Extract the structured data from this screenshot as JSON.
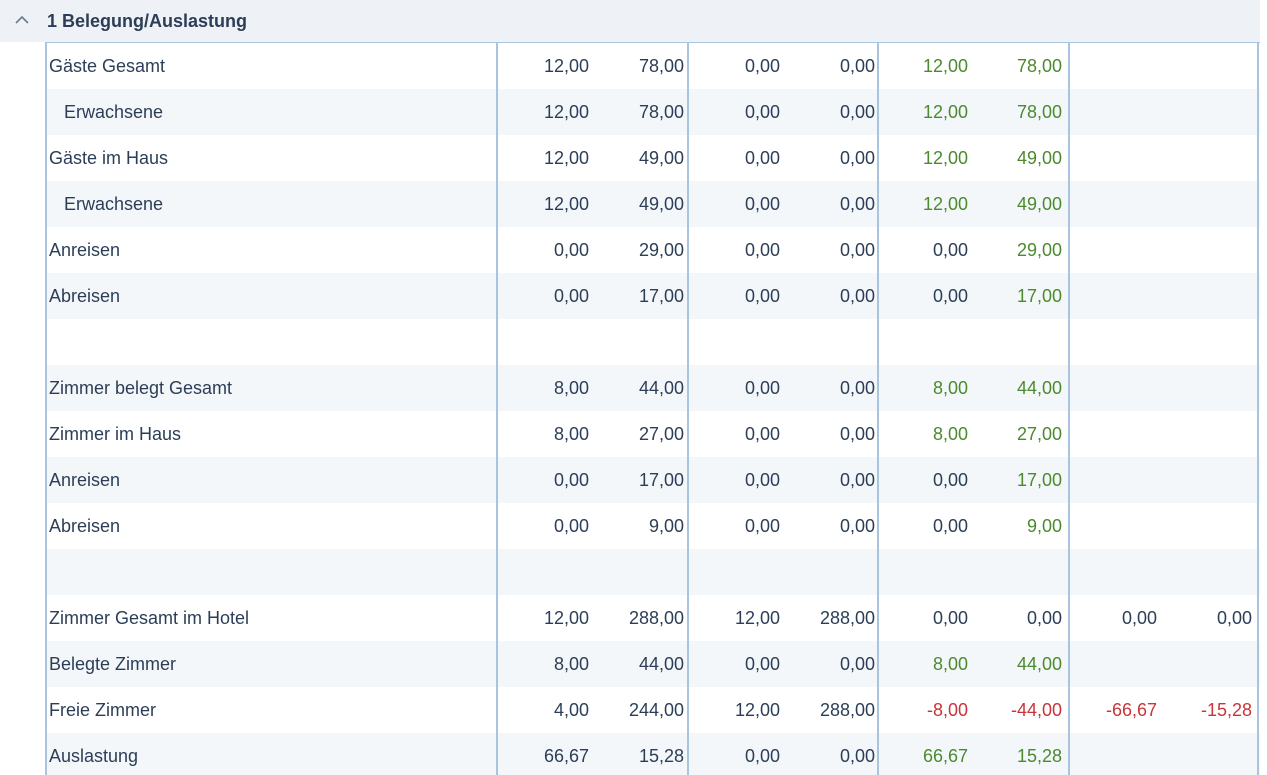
{
  "section": {
    "title": "1 Belegung/Auslastung",
    "icon": "chevron-up-icon"
  },
  "colors": {
    "green": "#4b8a2e",
    "red": "#c8343a",
    "text": "#2c3e57",
    "grid_line": "#a9c4de"
  },
  "rows": [
    {
      "label": "Gäste Gesamt",
      "indent": false,
      "values": [
        "12,00",
        "78,00",
        "0,00",
        "0,00",
        "12,00",
        "78,00",
        "",
        ""
      ],
      "tones": [
        "",
        "",
        "",
        "",
        "green",
        "green",
        "",
        ""
      ]
    },
    {
      "label": "Erwachsene",
      "indent": true,
      "values": [
        "12,00",
        "78,00",
        "0,00",
        "0,00",
        "12,00",
        "78,00",
        "",
        ""
      ],
      "tones": [
        "",
        "",
        "",
        "",
        "green",
        "green",
        "",
        ""
      ]
    },
    {
      "label": "Gäste im Haus",
      "indent": false,
      "values": [
        "12,00",
        "49,00",
        "0,00",
        "0,00",
        "12,00",
        "49,00",
        "",
        ""
      ],
      "tones": [
        "",
        "",
        "",
        "",
        "green",
        "green",
        "",
        ""
      ]
    },
    {
      "label": "Erwachsene",
      "indent": true,
      "values": [
        "12,00",
        "49,00",
        "0,00",
        "0,00",
        "12,00",
        "49,00",
        "",
        ""
      ],
      "tones": [
        "",
        "",
        "",
        "",
        "green",
        "green",
        "",
        ""
      ]
    },
    {
      "label": "Anreisen",
      "indent": false,
      "values": [
        "0,00",
        "29,00",
        "0,00",
        "0,00",
        "0,00",
        "29,00",
        "",
        ""
      ],
      "tones": [
        "",
        "",
        "",
        "",
        "",
        "green",
        "",
        ""
      ]
    },
    {
      "label": "Abreisen",
      "indent": false,
      "values": [
        "0,00",
        "17,00",
        "0,00",
        "0,00",
        "0,00",
        "17,00",
        "",
        ""
      ],
      "tones": [
        "",
        "",
        "",
        "",
        "",
        "green",
        "",
        ""
      ]
    },
    {
      "label": "",
      "indent": false,
      "values": [
        "",
        "",
        "",
        "",
        "",
        "",
        "",
        ""
      ],
      "tones": [
        "",
        "",
        "",
        "",
        "",
        "",
        "",
        ""
      ]
    },
    {
      "label": "Zimmer belegt Gesamt",
      "indent": false,
      "values": [
        "8,00",
        "44,00",
        "0,00",
        "0,00",
        "8,00",
        "44,00",
        "",
        ""
      ],
      "tones": [
        "",
        "",
        "",
        "",
        "green",
        "green",
        "",
        ""
      ]
    },
    {
      "label": "Zimmer im Haus",
      "indent": false,
      "values": [
        "8,00",
        "27,00",
        "0,00",
        "0,00",
        "8,00",
        "27,00",
        "",
        ""
      ],
      "tones": [
        "",
        "",
        "",
        "",
        "green",
        "green",
        "",
        ""
      ]
    },
    {
      "label": "Anreisen",
      "indent": false,
      "values": [
        "0,00",
        "17,00",
        "0,00",
        "0,00",
        "0,00",
        "17,00",
        "",
        ""
      ],
      "tones": [
        "",
        "",
        "",
        "",
        "",
        "green",
        "",
        ""
      ]
    },
    {
      "label": "Abreisen",
      "indent": false,
      "values": [
        "0,00",
        "9,00",
        "0,00",
        "0,00",
        "0,00",
        "9,00",
        "",
        ""
      ],
      "tones": [
        "",
        "",
        "",
        "",
        "",
        "green",
        "",
        ""
      ]
    },
    {
      "label": "",
      "indent": false,
      "values": [
        "",
        "",
        "",
        "",
        "",
        "",
        "",
        ""
      ],
      "tones": [
        "",
        "",
        "",
        "",
        "",
        "",
        "",
        ""
      ]
    },
    {
      "label": "Zimmer Gesamt im Hotel",
      "indent": false,
      "values": [
        "12,00",
        "288,00",
        "12,00",
        "288,00",
        "0,00",
        "0,00",
        "0,00",
        "0,00"
      ],
      "tones": [
        "",
        "",
        "",
        "",
        "",
        "",
        "",
        ""
      ]
    },
    {
      "label": "Belegte Zimmer",
      "indent": false,
      "values": [
        "8,00",
        "44,00",
        "0,00",
        "0,00",
        "8,00",
        "44,00",
        "",
        ""
      ],
      "tones": [
        "",
        "",
        "",
        "",
        "green",
        "green",
        "",
        ""
      ]
    },
    {
      "label": "Freie Zimmer",
      "indent": false,
      "values": [
        "4,00",
        "244,00",
        "12,00",
        "288,00",
        "-8,00",
        "-44,00",
        "-66,67",
        "-15,28"
      ],
      "tones": [
        "",
        "",
        "",
        "",
        "red",
        "red",
        "red",
        "red"
      ]
    },
    {
      "label": "Auslastung",
      "indent": false,
      "values": [
        "66,67",
        "15,28",
        "0,00",
        "0,00",
        "66,67",
        "15,28",
        "",
        ""
      ],
      "tones": [
        "",
        "",
        "",
        "",
        "green",
        "green",
        "",
        ""
      ]
    }
  ]
}
